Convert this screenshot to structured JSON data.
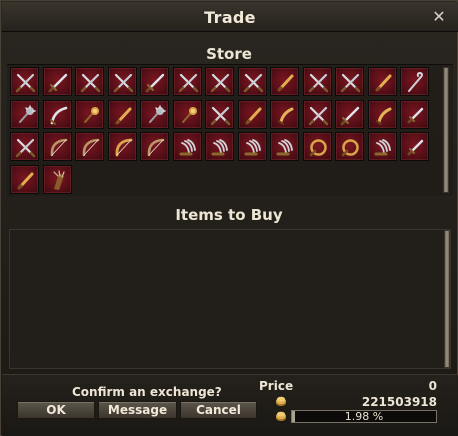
{
  "window": {
    "title": "Trade",
    "close_glyph": "✕"
  },
  "store": {
    "title": "Store",
    "items": [
      {
        "icon": "crossed-swords-icon"
      },
      {
        "icon": "sword-icon"
      },
      {
        "icon": "crossed-swords-icon"
      },
      {
        "icon": "crossed-swords-icon"
      },
      {
        "icon": "sword-icon"
      },
      {
        "icon": "crossed-swords-icon"
      },
      {
        "icon": "crossed-swords-icon"
      },
      {
        "icon": "crossed-swords-icon"
      },
      {
        "icon": "golden-blade-icon"
      },
      {
        "icon": "crossed-swords-icon"
      },
      {
        "icon": "crossed-swords-icon"
      },
      {
        "icon": "golden-blade-icon"
      },
      {
        "icon": "hook-staff-icon"
      },
      {
        "icon": "mace-icon"
      },
      {
        "icon": "scimitar-icon"
      },
      {
        "icon": "golden-mace-icon"
      },
      {
        "icon": "golden-blade-icon"
      },
      {
        "icon": "mace-icon"
      },
      {
        "icon": "golden-mace-icon"
      },
      {
        "icon": "crossed-swords-icon"
      },
      {
        "icon": "golden-blade-icon"
      },
      {
        "icon": "curved-dagger-icon"
      },
      {
        "icon": "crossed-swords-icon"
      },
      {
        "icon": "sword-icon"
      },
      {
        "icon": "curved-dagger-icon"
      },
      {
        "icon": "dagger-icon"
      },
      {
        "icon": "crossed-swords-icon"
      },
      {
        "icon": "bow-icon"
      },
      {
        "icon": "bow-icon"
      },
      {
        "icon": "golden-bow-icon"
      },
      {
        "icon": "bow-icon"
      },
      {
        "icon": "claw-icon"
      },
      {
        "icon": "claw-icon"
      },
      {
        "icon": "claw-icon"
      },
      {
        "icon": "claw-icon"
      },
      {
        "icon": "golden-ring-blade-icon"
      },
      {
        "icon": "golden-ring-blade-icon"
      },
      {
        "icon": "claw-icon"
      },
      {
        "icon": "dagger-icon"
      },
      {
        "icon": "golden-blade-icon"
      },
      {
        "icon": "quiver-icon"
      }
    ]
  },
  "buy": {
    "title": "Items to Buy"
  },
  "footer": {
    "confirm_text": "Confirm an exchange?",
    "buttons": {
      "ok": "OK",
      "message": "Message",
      "cancel": "Cancel"
    },
    "price_label": "Price",
    "price_value": "0",
    "gold_value": "221503918",
    "progress": {
      "percent": 1.98,
      "text": "1.98 %"
    }
  },
  "colors": {
    "slot_red": "#6a121c",
    "gold": "#d6a24a",
    "panel": "#221f1b"
  }
}
